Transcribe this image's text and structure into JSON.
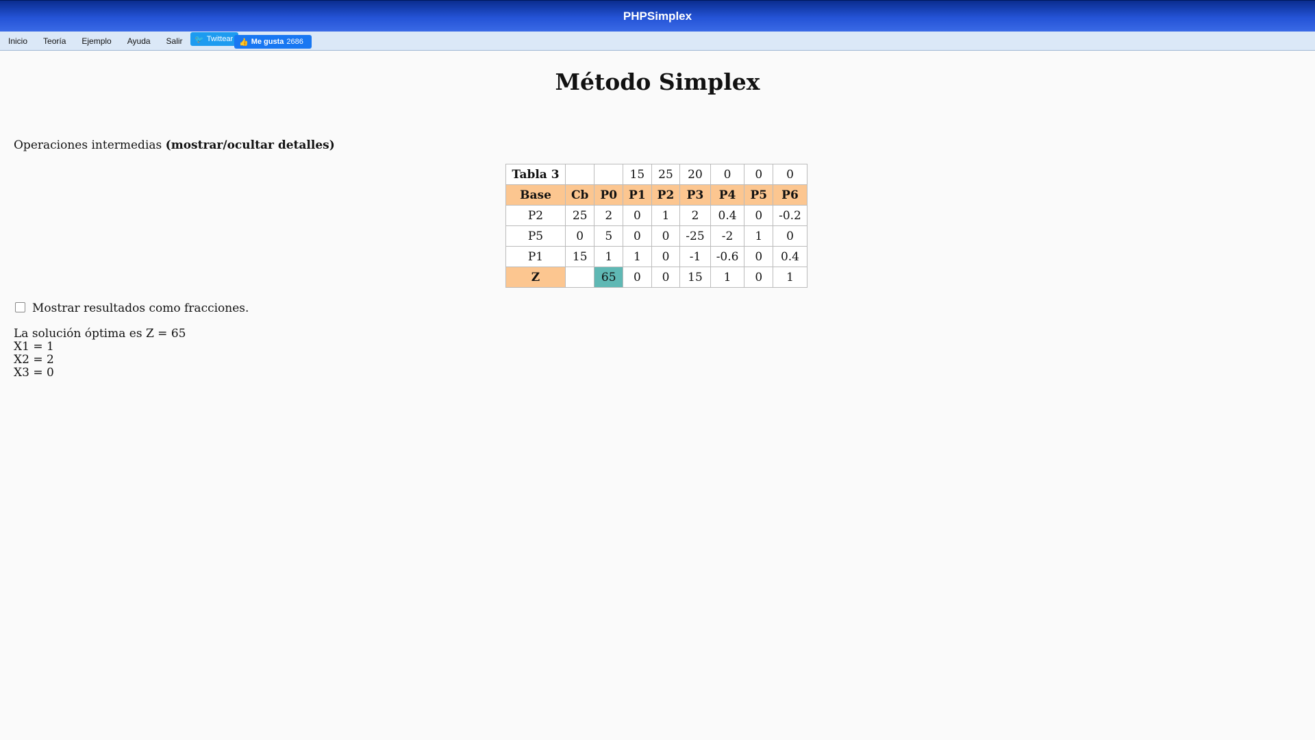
{
  "app": {
    "title": "PHPSimplex"
  },
  "menu": {
    "items": [
      "Inicio",
      "Teoría",
      "Ejemplo",
      "Ayuda",
      "Salir"
    ],
    "twitter_label": "Twittear",
    "like_label": "Me gusta",
    "like_count": "2686"
  },
  "page": {
    "title": "Método Simplex",
    "ops_label": "Operaciones intermedias",
    "ops_toggle": "(mostrar/ocultar detalles)"
  },
  "table": {
    "title": "Tabla 3",
    "costs": [
      "",
      "",
      "15",
      "25",
      "20",
      "0",
      "0",
      "0"
    ],
    "headers": [
      "Base",
      "Cb",
      "P0",
      "P1",
      "P2",
      "P3",
      "P4",
      "P5",
      "P6"
    ],
    "rows": [
      [
        "P2",
        "25",
        "2",
        "0",
        "1",
        "2",
        "0.4",
        "0",
        "-0.2"
      ],
      [
        "P5",
        "0",
        "5",
        "0",
        "0",
        "-25",
        "-2",
        "1",
        "0"
      ],
      [
        "P1",
        "15",
        "1",
        "1",
        "0",
        "-1",
        "-0.6",
        "0",
        "0.4"
      ]
    ],
    "z_row": [
      "Z",
      "",
      "65",
      "0",
      "0",
      "15",
      "1",
      "0",
      "1"
    ]
  },
  "fraction_label": "Mostrar resultados como fracciones.",
  "solution": {
    "line": "La solución óptima es Z = 65",
    "vars": [
      "X1 = 1",
      "X2 = 2",
      "X3 = 0"
    ]
  },
  "colors": {
    "header_bg": "#fcc690",
    "pivot_bg": "#5fb8b4",
    "topbar": "#2453d6"
  }
}
